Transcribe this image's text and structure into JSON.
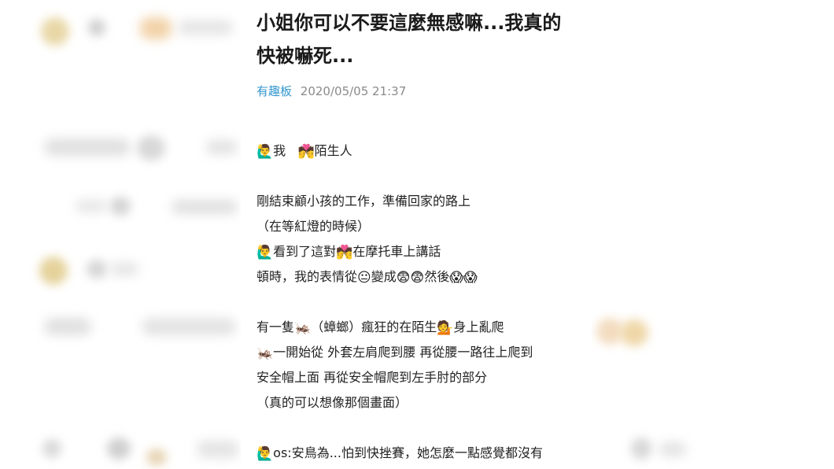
{
  "post": {
    "title": "小姐你可以不要這麼無感嘛...我真的快被嚇死...",
    "board": "有趣板",
    "timestamp": "2020/05/05 21:37"
  },
  "content": {
    "cast_me": "我",
    "cast_stranger": "陌生人",
    "p1_l1": "剛結束顧小孩的工作，準備回家的路上",
    "p1_l2": "（在等紅燈的時候）",
    "p1_l3a": "看到了這對",
    "p1_l3b": "在摩托車上講話",
    "p1_l4a": "頓時，我的表情從",
    "p1_l4b": "變成",
    "p1_l4c": "然後",
    "p2_l1a": "有一隻",
    "p2_l1b": "（蟑螂）瘋狂的在陌生",
    "p2_l1c": "身上亂爬",
    "p2_l2": "一開始從 外套左肩爬到腰 再從腰一路往上爬到",
    "p2_l3": "安全帽上面 再從安全帽爬到左手肘的部分",
    "p2_l4": "（真的可以想像那個畫面）",
    "p3_l1": "os:安鳥為...怕到快挫賽，她怎麼一點感覺都沒有"
  },
  "emoji": {
    "raising_hand": "🙋‍♂️",
    "couple_heart": "💏",
    "neutral_face": "😐",
    "fearful_face": "😨",
    "screaming_face": "😱",
    "cricket": "🦗",
    "tipping_hand": "💁"
  }
}
